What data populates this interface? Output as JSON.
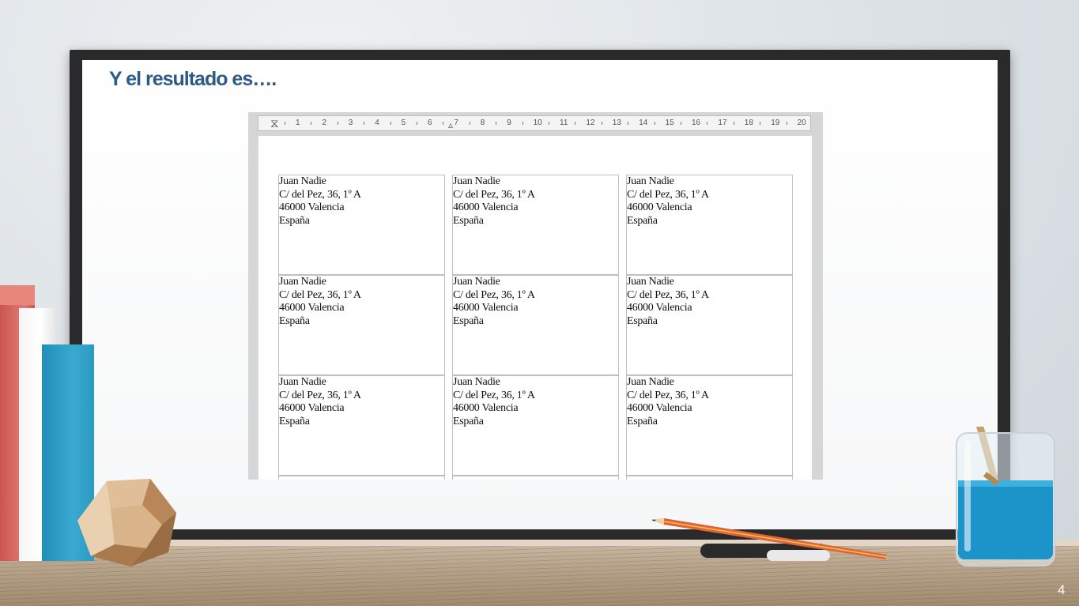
{
  "slide": {
    "title": "Y el resultado es….",
    "page_number": "4"
  },
  "ruler": {
    "marks": [
      "1",
      "2",
      "3",
      "4",
      "5",
      "6",
      "7",
      "8",
      "9",
      "10",
      "11",
      "12",
      "13",
      "14",
      "15",
      "16",
      "17",
      "18",
      "19",
      "20"
    ]
  },
  "labels": [
    {
      "name": "Juan Nadie",
      "street": "C/ del Pez, 36, 1º A",
      "city": "46000 Valencia",
      "country": "España"
    },
    {
      "name": "Juan Nadie",
      "street": "C/ del Pez, 36, 1º A",
      "city": "46000 Valencia",
      "country": "España"
    },
    {
      "name": "Juan Nadie",
      "street": "C/ del Pez, 36, 1º A",
      "city": "46000 Valencia",
      "country": "España"
    },
    {
      "name": "Juan Nadie",
      "street": "C/ del Pez, 36, 1º A",
      "city": "46000 Valencia",
      "country": "España"
    },
    {
      "name": "Juan Nadie",
      "street": "C/ del Pez, 36, 1º A",
      "city": "46000 Valencia",
      "country": "España"
    },
    {
      "name": "Juan Nadie",
      "street": "C/ del Pez, 36, 1º A",
      "city": "46000 Valencia",
      "country": "España"
    },
    {
      "name": "Juan Nadie",
      "street": "C/ del Pez, 36, 1º A",
      "city": "46000 Valencia",
      "country": "España"
    },
    {
      "name": "Juan Nadie",
      "street": "C/ del Pez, 36, 1º A",
      "city": "46000 Valencia",
      "country": "España"
    },
    {
      "name": "Juan Nadie",
      "street": "C/ del Pez, 36, 1º A",
      "city": "46000 Valencia",
      "country": "España"
    }
  ],
  "colors": {
    "title": "#2c5a86",
    "board_frame": "#2a2a2a",
    "label_border": "#bfbfbf"
  }
}
